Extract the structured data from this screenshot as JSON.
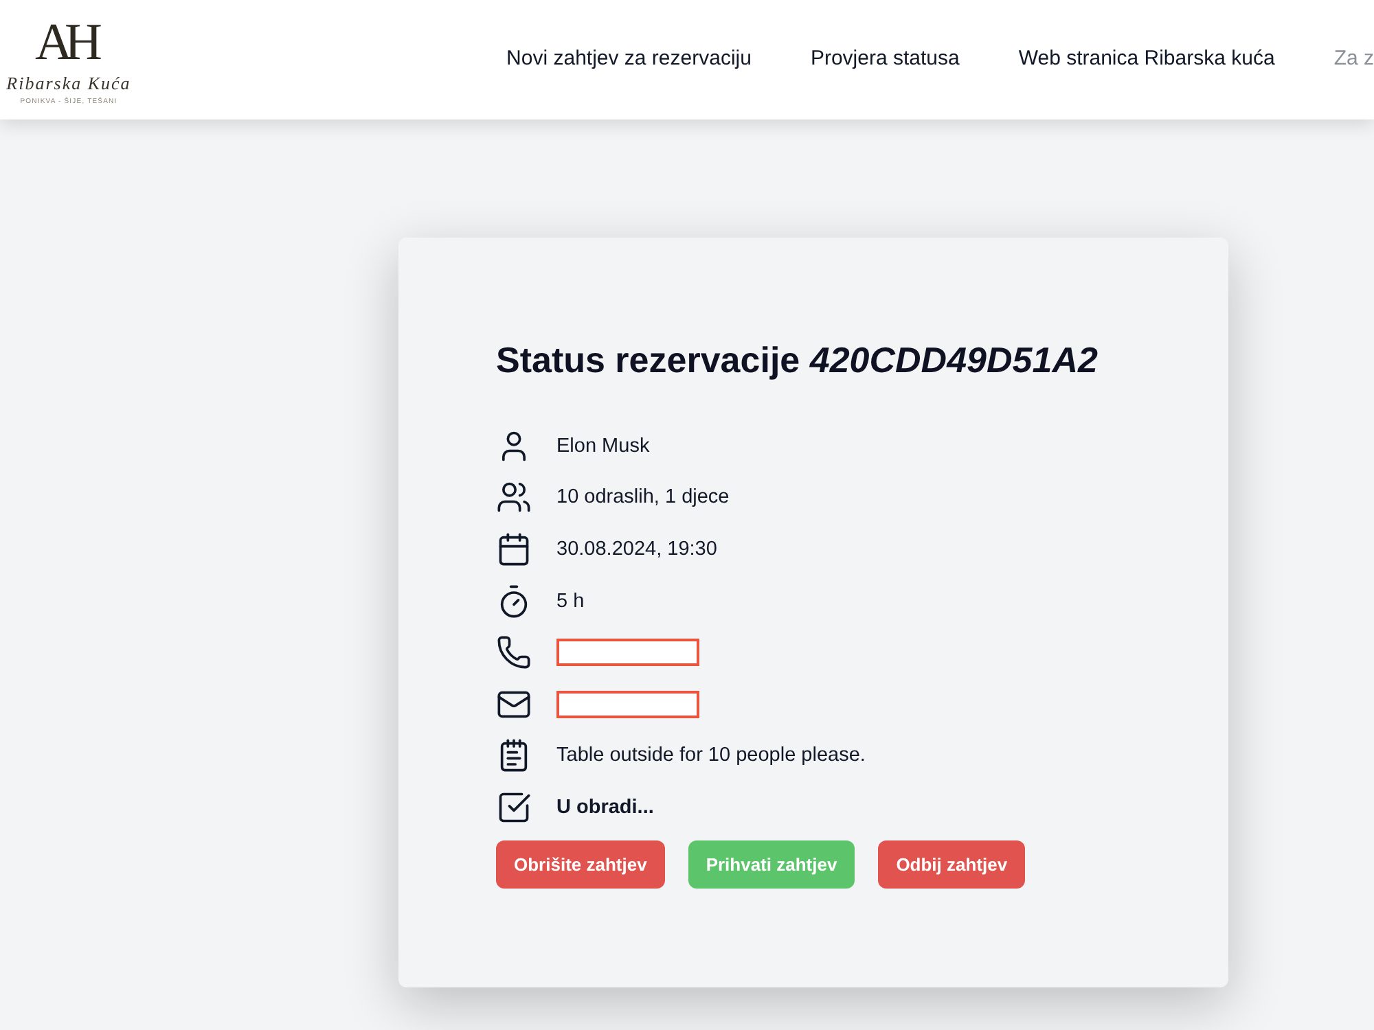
{
  "logo": {
    "monogram": "AH",
    "name": "Ribarska Kuća",
    "tagline": "PONIKVA - ŠIJE, TEŠANI"
  },
  "nav": [
    {
      "label": "Novi zahtjev za rezervaciju",
      "kind": "link"
    },
    {
      "label": "Provjera statusa",
      "kind": "link"
    },
    {
      "label": "Web stranica Ribarska kuća",
      "kind": "link"
    },
    {
      "label": "Za z",
      "kind": "muted"
    }
  ],
  "card": {
    "title": "Status rezervacije",
    "code": "420CDD49D51A2",
    "details": [
      {
        "kind": "guest",
        "value": "Elon Musk"
      },
      {
        "kind": "party",
        "value": "10 odraslih, 1 djece"
      },
      {
        "kind": "datetime",
        "value": "30.08.2024, 19:30"
      },
      {
        "kind": "duration",
        "value": "5 h"
      },
      {
        "kind": "phone",
        "redacted": true
      },
      {
        "kind": "email",
        "redacted": true
      },
      {
        "kind": "note",
        "value": "Table outside for 10 people please."
      },
      {
        "kind": "status",
        "value": "U obradi..."
      }
    ],
    "buttons": [
      {
        "label": "Obrišite zahtjev",
        "kind": "danger"
      },
      {
        "label": "Prihvati zahtjev",
        "kind": "success"
      },
      {
        "label": "Odbij zahtjev",
        "kind": "danger"
      }
    ]
  }
}
